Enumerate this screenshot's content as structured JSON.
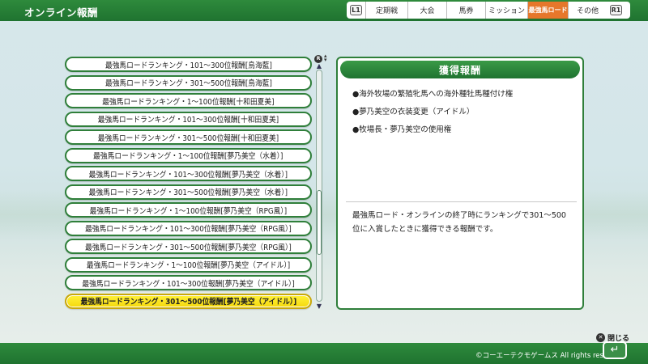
{
  "header": {
    "title": "オンライン報酬",
    "shoulder_left": "L1",
    "shoulder_right": "R1",
    "tabs": [
      {
        "label": "定期戦"
      },
      {
        "label": "大会"
      },
      {
        "label": "馬券"
      },
      {
        "label": "ミッション"
      },
      {
        "label": "最強馬ロード"
      },
      {
        "label": "その他"
      }
    ],
    "active_tab_index": 4
  },
  "list": {
    "items": [
      {
        "label": "最強馬ロードランキング・101～300位報酬[鳥海藍]"
      },
      {
        "label": "最強馬ロードランキング・301～500位報酬[鳥海藍]"
      },
      {
        "label": "最強馬ロードランキング・1～100位報酬[十和田夏美]"
      },
      {
        "label": "最強馬ロードランキング・101～300位報酬[十和田夏美]"
      },
      {
        "label": "最強馬ロードランキング・301～500位報酬[十和田夏美]"
      },
      {
        "label": "最強馬ロードランキング・1～100位報酬[夢乃美空（水着）]"
      },
      {
        "label": "最強馬ロードランキング・101～300位報酬[夢乃美空（水着）]"
      },
      {
        "label": "最強馬ロードランキング・301～500位報酬[夢乃美空（水着）]"
      },
      {
        "label": "最強馬ロードランキング・1～100位報酬[夢乃美空（RPG風）]"
      },
      {
        "label": "最強馬ロードランキング・101～300位報酬[夢乃美空（RPG風）]"
      },
      {
        "label": "最強馬ロードランキング・301～500位報酬[夢乃美空（RPG風）]"
      },
      {
        "label": "最強馬ロードランキング・1～100位報酬[夢乃美空（アイドル）]"
      },
      {
        "label": "最強馬ロードランキング・101～300位報酬[夢乃美空（アイドル）]"
      },
      {
        "label": "最強馬ロードランキング・301～500位報酬[夢乃美空（アイドル）]"
      }
    ],
    "selected_index": 13
  },
  "scrollbar": {
    "thumb_position_fraction": 0.72,
    "thumb_size_fraction": 0.28
  },
  "panel": {
    "title": "獲得報酬",
    "rewards": [
      "●海外牧場の繁殖牝馬への海外種牡馬種付け権",
      "●夢乃美空の衣装変更（アイドル）",
      "●牧場長・夢乃美空の使用権"
    ],
    "description": "最強馬ロード・オンラインの終了時にランキングで301～500位に入賞したときに獲得できる報酬です。"
  },
  "footer": {
    "close_label": "閉じる",
    "copyright": "©コーエーテクモゲームス All rights reserved."
  },
  "colors": {
    "brand_green": "#1f7330",
    "active_tab": "#e6772b",
    "selected_item": "#f5d80c"
  }
}
